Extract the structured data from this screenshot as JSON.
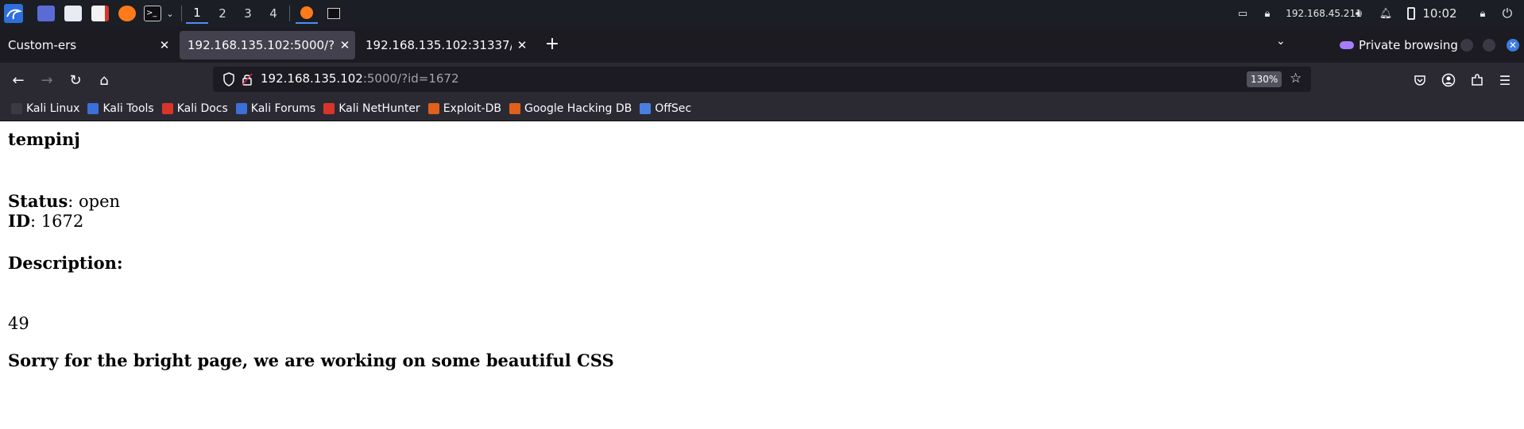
{
  "taskbar": {
    "workspaces": [
      "1",
      "2",
      "3",
      "4"
    ],
    "active_workspace": "1",
    "ip_address": "192.168.45.211",
    "clock": "10:02"
  },
  "tabs": [
    {
      "title": "Custom-ers",
      "selected": false
    },
    {
      "title": "192.168.135.102:5000/?id=1672",
      "selected": true
    },
    {
      "title": "192.168.135.102:31337/",
      "selected": false
    }
  ],
  "private_label": "Private browsing",
  "urlbar": {
    "host": "192.168.135.102",
    "path": ":5000/?id=1672",
    "zoom": "130%"
  },
  "bookmarks": [
    {
      "label": "Kali Linux",
      "color": "#3a3a44"
    },
    {
      "label": "Kali Tools",
      "color": "#3d6fd8"
    },
    {
      "label": "Kali Docs",
      "color": "#d8352a"
    },
    {
      "label": "Kali Forums",
      "color": "#3d6fd8"
    },
    {
      "label": "Kali NetHunter",
      "color": "#d8352a"
    },
    {
      "label": "Exploit-DB",
      "color": "#e0601c"
    },
    {
      "label": "Google Hacking DB",
      "color": "#e0601c"
    },
    {
      "label": "OffSec",
      "color": "#4a7fe0"
    }
  ],
  "page": {
    "title": "tempinj",
    "status_label": "Status",
    "status_value": ": open",
    "id_label": "ID",
    "id_value": ": 1672",
    "description_heading": "Description:",
    "description_value": "49",
    "footer_note": "Sorry for the bright page, we are working on some beautiful CSS"
  }
}
